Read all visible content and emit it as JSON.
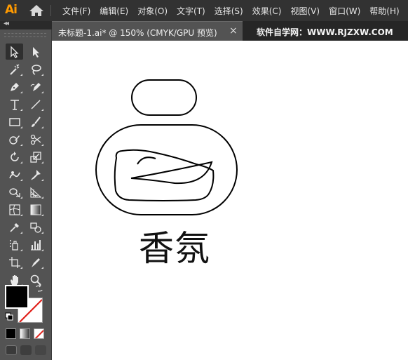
{
  "app": {
    "logo": "Ai"
  },
  "menu": [
    "文件(F)",
    "编辑(E)",
    "对象(O)",
    "文字(T)",
    "选择(S)",
    "效果(C)",
    "视图(V)",
    "窗口(W)",
    "帮助(H)"
  ],
  "tab": {
    "title": "未标题-1.ai* @ 150% (CMYK/GPU 预览)",
    "close": "×"
  },
  "site": "软件自学网：WWW.RJZXW.COM",
  "toolbar": {
    "collapse": "◂◂"
  },
  "artwork": {
    "text": "香氛"
  },
  "colors": {
    "fill": "#000000",
    "stroke": "none",
    "accent": "#ff9a00"
  },
  "tools": [
    "selection-tool",
    "direct-selection-tool",
    "magic-wand-tool",
    "lasso-tool",
    "pen-tool",
    "curvature-tool",
    "type-tool",
    "line-segment-tool",
    "rectangle-tool",
    "paintbrush-tool",
    "shaper-tool",
    "scissors-tool",
    "rotate-tool",
    "scale-tool",
    "warp-tool",
    "puppet-warp-tool",
    "shape-builder-tool",
    "perspective-grid-tool",
    "mesh-tool",
    "gradient-tool",
    "eyedropper-tool",
    "blend-tool",
    "symbol-sprayer-tool",
    "column-graph-tool",
    "artboard-tool",
    "slice-tool",
    "hand-tool",
    "zoom-tool"
  ]
}
